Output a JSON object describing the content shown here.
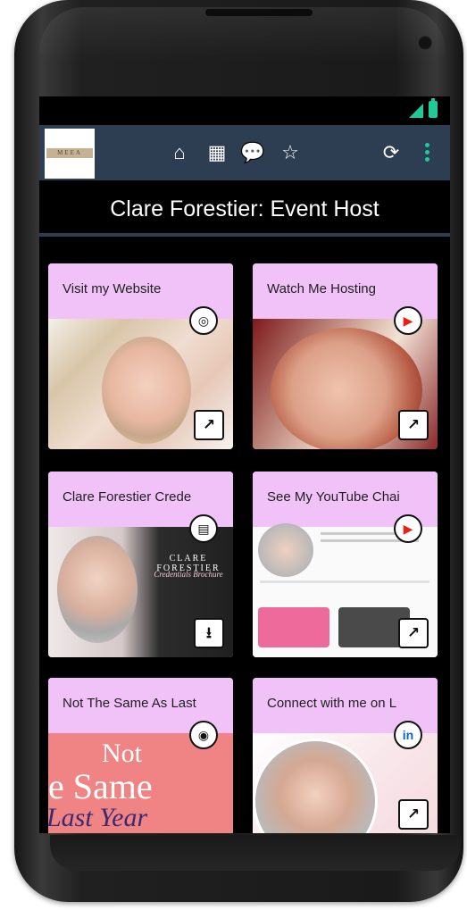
{
  "app": {
    "title": "Clare Forestier: Event Host",
    "logo_text": "MEEA",
    "nav": [
      "home-icon",
      "qr-code-icon",
      "chat-icon",
      "star-icon",
      "refresh-icon",
      "more-vertical-icon"
    ],
    "accent": "#20c997",
    "header_bg": "#2e3e52",
    "card_head_bg": "#f0c2f7"
  },
  "cards": [
    {
      "label": "Visit my Website",
      "badge": "website-icon",
      "action": "external-link-icon",
      "action_glyph": "↗"
    },
    {
      "label": "Watch Me Hosting",
      "badge": "youtube-icon",
      "action": "external-link-icon",
      "action_glyph": "↗"
    },
    {
      "label": "Clare Forestier Crede",
      "badge": "document-icon",
      "action": "download-icon",
      "action_glyph": "⭳"
    },
    {
      "label": "See My YouTube Chai",
      "badge": "youtube-icon",
      "action": "external-link-icon",
      "action_glyph": "↗"
    },
    {
      "label": "Not The Same As Last",
      "badge": "rss-icon",
      "action": "",
      "action_glyph": ""
    },
    {
      "label": "Connect with me on L",
      "badge": "linkedin-icon",
      "action": "external-link-icon",
      "action_glyph": "↗"
    }
  ]
}
